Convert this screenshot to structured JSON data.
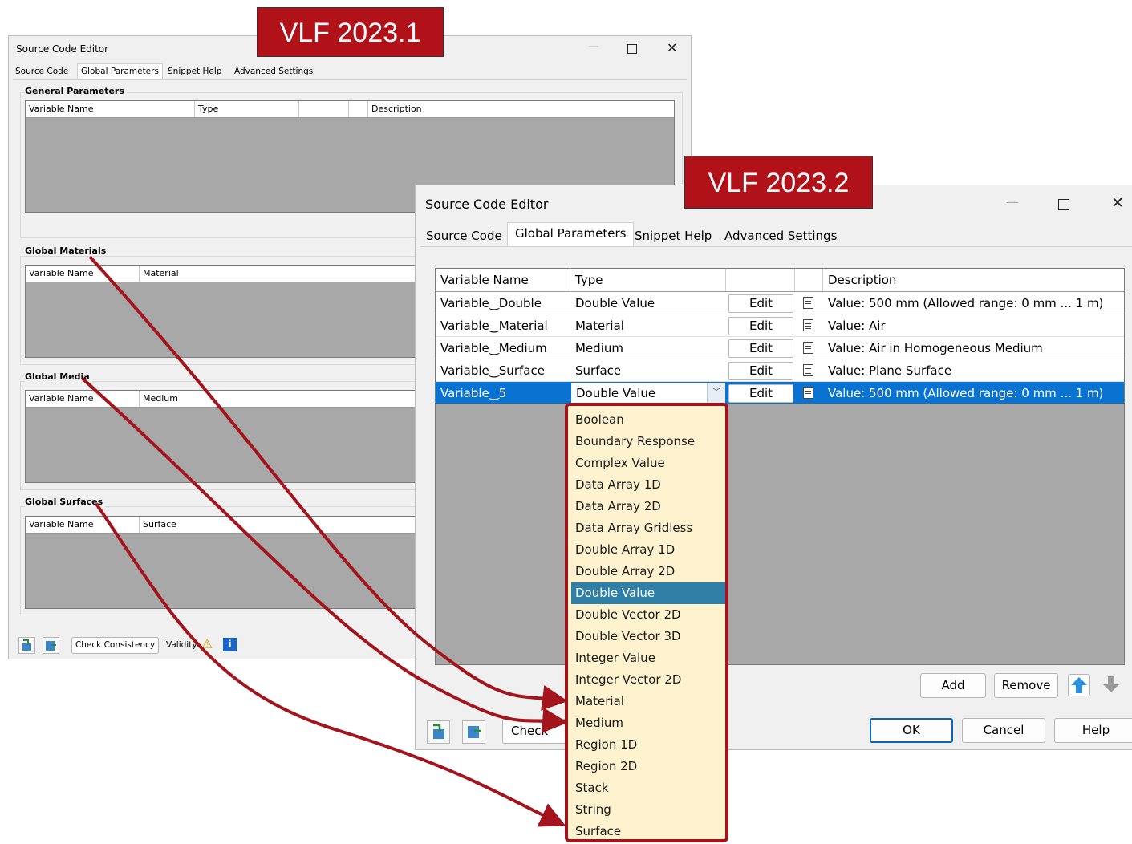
{
  "old_window": {
    "title": "Source Code Editor",
    "tabs": [
      "Source Code",
      "Global Parameters",
      "Snippet Help",
      "Advanced Settings"
    ],
    "groups": [
      {
        "title": "General Parameters",
        "columns": [
          "Variable Name",
          "Type",
          "",
          "",
          "Description"
        ]
      },
      {
        "title": "Global Materials",
        "columns": [
          "Variable Name",
          "Material"
        ]
      },
      {
        "title": "Global Media",
        "columns": [
          "Variable Name",
          "Medium"
        ]
      },
      {
        "title": "Global Surfaces",
        "columns": [
          "Variable Name",
          "Surface"
        ]
      }
    ],
    "check_consistency": "Check Consistency",
    "validity_label": "Validity:"
  },
  "badges": {
    "old": "VLF 2023.1",
    "new": "VLF 2023.2"
  },
  "new_window": {
    "title": "Source Code Editor",
    "tabs": [
      "Source Code",
      "Global Parameters",
      "Snippet Help",
      "Advanced Settings"
    ],
    "columns": [
      "Variable Name",
      "Type",
      "",
      "",
      "Description"
    ],
    "rows": [
      {
        "name": "Variable‿Double",
        "type": "Double Value",
        "edit": "Edit",
        "desc": "Value: 500 mm (Allowed range: 0 mm ... 1 m)"
      },
      {
        "name": "Variable‿Material",
        "type": "Material",
        "edit": "Edit",
        "desc": "Value: Air"
      },
      {
        "name": "Variable‿Medium",
        "type": "Medium",
        "edit": "Edit",
        "desc": "Value: Air in Homogeneous Medium"
      },
      {
        "name": "Variable‿Surface",
        "type": "Surface",
        "edit": "Edit",
        "desc": "Value: Plane Surface"
      },
      {
        "name": "Variable‿5",
        "type": "Double Value",
        "edit": "Edit",
        "desc": "Value: 500 mm (Allowed range: 0 mm ... 1 m)"
      }
    ],
    "dropdown_options": [
      "Boolean",
      "Boundary Response",
      "Complex Value",
      "Data Array 1D",
      "Data Array 2D",
      "Data Array Gridless",
      "Double Array 1D",
      "Double Array 2D",
      "Double Value",
      "Double Vector 2D",
      "Double Vector 3D",
      "Integer Value",
      "Integer Vector 2D",
      "Material",
      "Medium",
      "Region 1D",
      "Region 2D",
      "Stack",
      "String",
      "Surface"
    ],
    "selected_option": "Double Value",
    "add": "Add",
    "remove": "Remove",
    "check": "Check",
    "ok": "OK",
    "cancel": "Cancel",
    "help": "Help"
  },
  "colors": {
    "badge": "#b11219",
    "selection": "#0a73d1",
    "dropdown_bg": "#fff3cf",
    "dropdown_highlight": "#2f7fa6",
    "arrow": "#a3141c"
  }
}
